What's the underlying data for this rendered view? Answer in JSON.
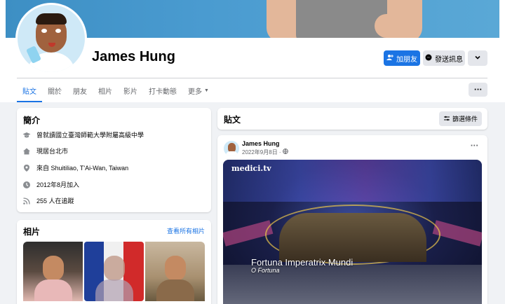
{
  "profile": {
    "name": "James Hung",
    "add_friend_label": "加朋友",
    "message_label": "發送訊息"
  },
  "tabs": [
    "貼文",
    "關於",
    "朋友",
    "相片",
    "影片",
    "打卡動態",
    "更多"
  ],
  "intro": {
    "title": "簡介",
    "items": [
      {
        "icon": "education-icon",
        "text": "曾就讀國立臺灣師範大學附屬高級中學"
      },
      {
        "icon": "home-icon",
        "text": "現居台北市"
      },
      {
        "icon": "location-icon",
        "text": "來自 Shuitiliao, T'Ai-Wan, Taiwan"
      },
      {
        "icon": "clock-icon",
        "text": "2012年8月加入"
      },
      {
        "icon": "rss-icon",
        "text": "255 人在追蹤"
      }
    ]
  },
  "photos": {
    "title": "相片",
    "see_all": "查看所有相片"
  },
  "posts": {
    "title": "貼文",
    "filter_label": "篩選條件"
  },
  "post": {
    "author": "James Hung",
    "date": "2022年9月8日 · ",
    "media": {
      "logo": "medici.tv",
      "title": "Fortuna Imperatrix Mundi",
      "subtitle": "O Fortuna"
    }
  },
  "colors": {
    "accent": "#1b74e4",
    "page_bg": "#f0f2f5",
    "button_bg": "#e4e6eb"
  }
}
